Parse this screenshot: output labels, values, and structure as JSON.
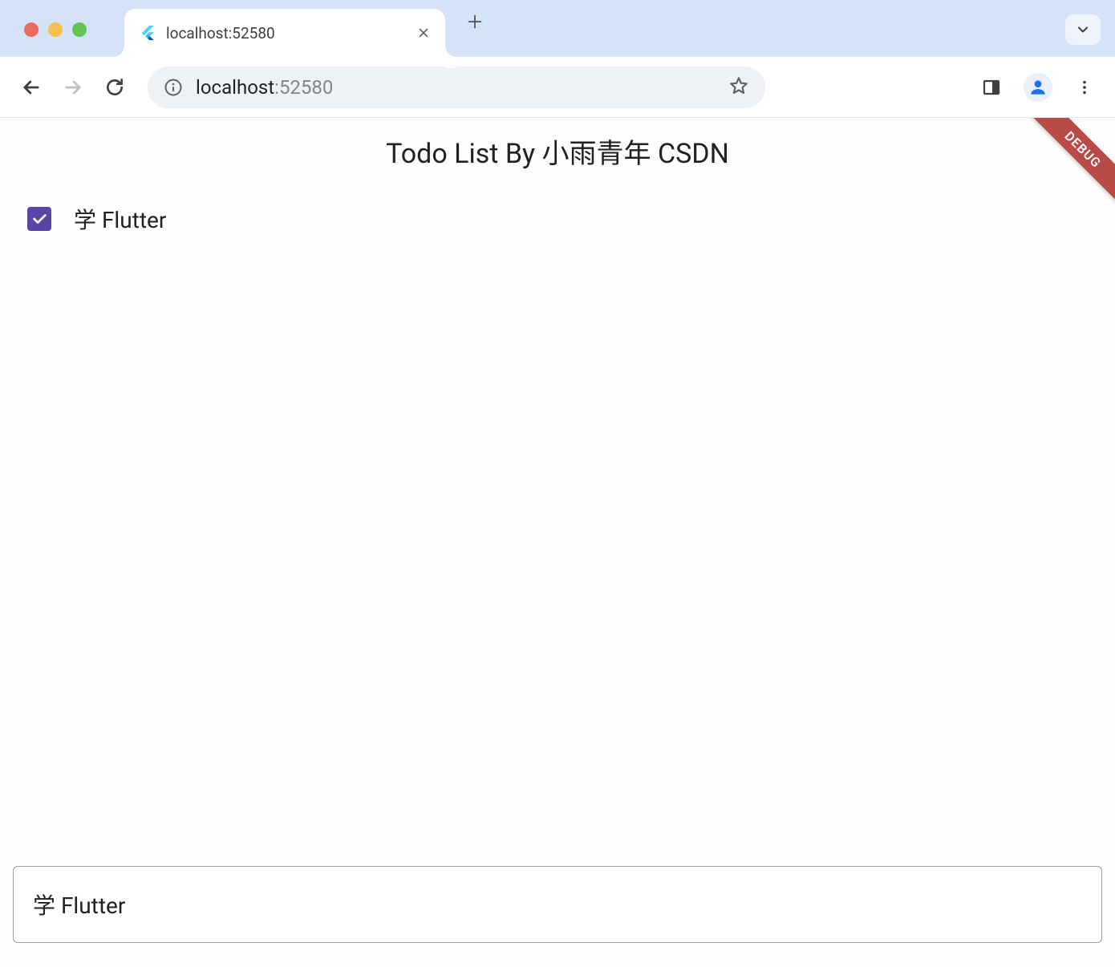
{
  "browser": {
    "tab": {
      "title": "localhost:52580"
    },
    "omnibox": {
      "host": "localhost",
      "port": ":52580"
    }
  },
  "app": {
    "title": "Todo List By 小雨青年 CSDN",
    "debug_banner": "DEBUG",
    "todos": [
      {
        "label": "学 Flutter",
        "checked": true
      }
    ],
    "input": {
      "value": "学 Flutter"
    }
  },
  "colors": {
    "checkbox": "#5a44a5",
    "debug": "#b94a48",
    "chrome_bg": "#d5e2f8"
  }
}
